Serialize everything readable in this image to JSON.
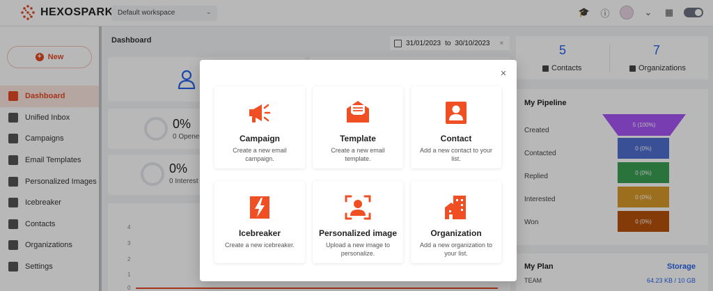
{
  "header": {
    "brand": "HEXOSPARK",
    "workspace": "Default workspace"
  },
  "sidebar": {
    "new_label": "New",
    "items": [
      {
        "label": "Dashboard",
        "icon": "dashboard-icon",
        "active": true
      },
      {
        "label": "Unified Inbox",
        "icon": "inbox-icon"
      },
      {
        "label": "Campaigns",
        "icon": "megaphone-icon"
      },
      {
        "label": "Email Templates",
        "icon": "template-icon"
      },
      {
        "label": "Personalized Images",
        "icon": "image-icon"
      },
      {
        "label": "Icebreaker",
        "icon": "icebreaker-icon"
      },
      {
        "label": "Contacts",
        "icon": "contacts-icon"
      },
      {
        "label": "Organizations",
        "icon": "organizations-icon"
      },
      {
        "label": "Settings",
        "icon": "settings-icon"
      }
    ]
  },
  "main": {
    "title": "Dashboard",
    "date_from": "31/01/2023",
    "date_to_word": "to",
    "date_to": "30/10/2023",
    "clear": "×",
    "stats": [
      {
        "pct": "0%",
        "label": "0 Opene"
      },
      {
        "pct": "0%",
        "label": "0 Interest"
      }
    ],
    "chart_ticks": [
      "4",
      "3",
      "2",
      "1",
      "0"
    ]
  },
  "right": {
    "contacts_count": "5",
    "contacts_label": "Contacts",
    "orgs_count": "7",
    "orgs_label": "Organizations",
    "pipeline": {
      "title": "My Pipeline",
      "rows": [
        {
          "label": "Created",
          "value": "5 (100%)",
          "color": "#a855f7"
        },
        {
          "label": "Contacted",
          "value": "0 (0%)",
          "color": "#4f6fd0"
        },
        {
          "label": "Replied",
          "value": "0 (0%)",
          "color": "#3ba054"
        },
        {
          "label": "Interested",
          "value": "0 (0%)",
          "color": "#d99a2b"
        },
        {
          "label": "Won",
          "value": "0 (0%)",
          "color": "#b8520c"
        }
      ]
    },
    "plan": {
      "title": "My Plan",
      "link": "Storage",
      "tier": "TEAM",
      "usage": "64.23 KB / 10 GB"
    }
  },
  "modal": {
    "close": "×",
    "accent": "#f04e23",
    "tiles": [
      {
        "title": "Campaign",
        "desc": "Create a new email campaign.",
        "icon": "megaphone-icon"
      },
      {
        "title": "Template",
        "desc": "Create a new email template.",
        "icon": "envelope-icon"
      },
      {
        "title": "Contact",
        "desc": "Add a new contact to your list.",
        "icon": "contact-card-icon"
      },
      {
        "title": "Icebreaker",
        "desc": "Create a new icebreaker.",
        "icon": "lightning-icon"
      },
      {
        "title": "Personalized image",
        "desc": "Upload a new image to personalize.",
        "icon": "face-scan-icon"
      },
      {
        "title": "Organization",
        "desc": "Add a new organization to your list.",
        "icon": "building-icon"
      }
    ]
  }
}
